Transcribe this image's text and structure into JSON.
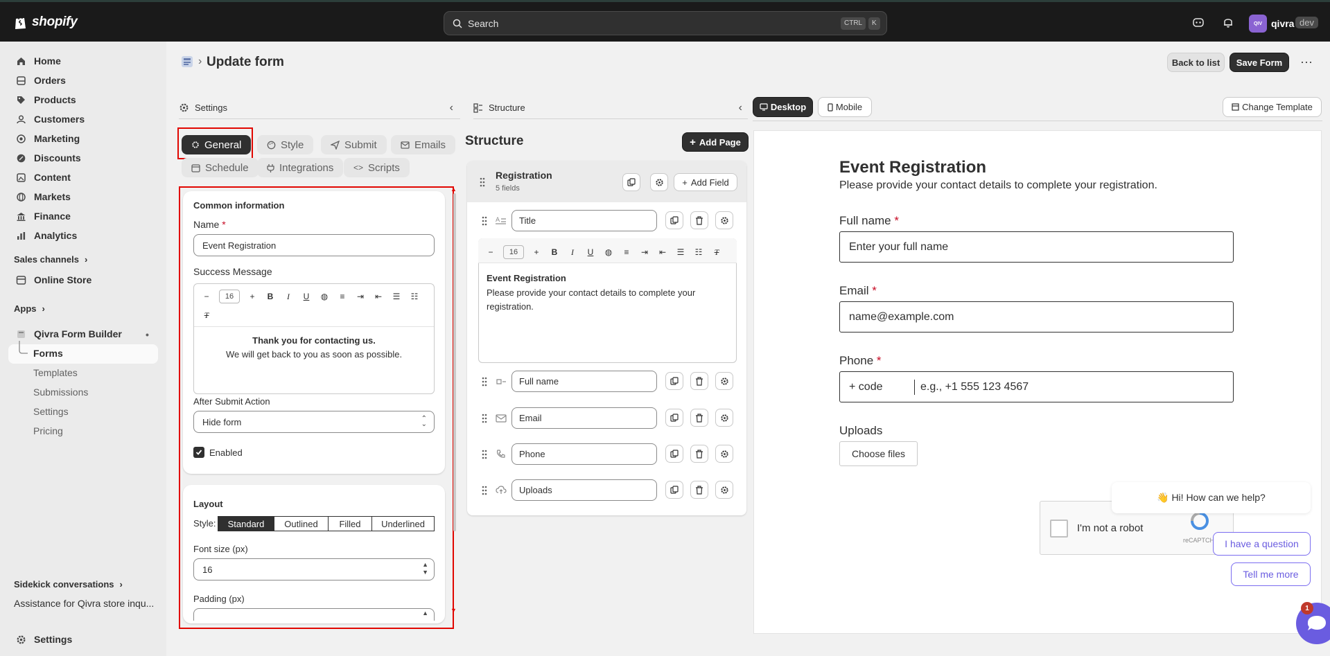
{
  "topbar": {
    "logo_text": "shopify",
    "search_placeholder": "Search",
    "shortcut_ctrl": "CTRL",
    "shortcut_k": "K",
    "avatar_initials": "QIV",
    "store_name": "qivra",
    "env_badge": "dev"
  },
  "sidebar": {
    "items": [
      {
        "label": "Home",
        "icon": "home-icon"
      },
      {
        "label": "Orders",
        "icon": "orders-icon"
      },
      {
        "label": "Products",
        "icon": "tag-icon"
      },
      {
        "label": "Customers",
        "icon": "person-icon"
      },
      {
        "label": "Marketing",
        "icon": "target-icon"
      },
      {
        "label": "Discounts",
        "icon": "discount-icon"
      },
      {
        "label": "Content",
        "icon": "content-icon"
      },
      {
        "label": "Markets",
        "icon": "globe-icon"
      },
      {
        "label": "Finance",
        "icon": "bank-icon"
      },
      {
        "label": "Analytics",
        "icon": "chart-icon"
      }
    ],
    "sales_channels_label": "Sales channels",
    "online_store_label": "Online Store",
    "apps_label": "Apps",
    "app_name": "Qivra Form Builder",
    "app_sub_items": [
      "Forms",
      "Templates",
      "Submissions",
      "Settings",
      "Pricing"
    ],
    "sidekick_label": "Sidekick conversations",
    "sidekick_item": "Assistance for Qivra store inqu...",
    "settings_label": "Settings"
  },
  "header": {
    "title": "Update form",
    "back_label": "Back to list",
    "save_label": "Save Form",
    "more_label": "⋯"
  },
  "settings_panel": {
    "title": "Settings",
    "tabs": [
      "General",
      "Style",
      "Submit",
      "Emails",
      "Schedule",
      "Integrations",
      "Scripts"
    ],
    "active_tab": "General",
    "common_heading": "Common information",
    "name_label": "Name",
    "name_value": "Event Registration",
    "success_label": "Success Message",
    "font_size_value": "16",
    "success_line1": "Thank you for contacting us.",
    "success_line2": "We will get back to you as soon as possible.",
    "after_submit_label": "After Submit Action",
    "after_submit_value": "Hide form",
    "enabled_label": "Enabled",
    "layout_heading": "Layout",
    "style_label": "Style:",
    "style_options": [
      "Standard",
      "Outlined",
      "Filled",
      "Underlined"
    ],
    "style_selected": "Standard",
    "font_size_label": "Font size (px)",
    "font_size_input": "16",
    "padding_label": "Padding (px)"
  },
  "structure_panel": {
    "title": "Structure",
    "heading": "Structure",
    "add_page_label": "Add Page",
    "page_name": "Registration",
    "page_count": "5 fields",
    "add_field_label": "Add Field",
    "editor_font_size": "16",
    "title_field": "Title",
    "editor_title": "Event Registration",
    "editor_body": "Please provide your contact details to complete your registration.",
    "fields": [
      "Full name",
      "Email",
      "Phone",
      "Uploads"
    ]
  },
  "preview": {
    "desktop_label": "Desktop",
    "mobile_label": "Mobile",
    "change_template_label": "Change Template",
    "form_title": "Event Registration",
    "form_subtitle": "Please provide your contact details to complete your registration.",
    "full_name_label": "Full name",
    "full_name_placeholder": "Enter your full name",
    "email_label": "Email",
    "email_placeholder": "name@example.com",
    "phone_label": "Phone",
    "phone_code": "+ code",
    "phone_placeholder": "e.g., +1 555 123 4567",
    "uploads_label": "Uploads",
    "choose_files_label": "Choose files",
    "captcha_label": "I'm not a robot",
    "captcha_brand": "reCAPTCHA"
  },
  "chat": {
    "greeting": "👋 Hi! How can we help?",
    "question_label": "I have a question",
    "more_label": "Tell me more",
    "badge_count": "1"
  }
}
